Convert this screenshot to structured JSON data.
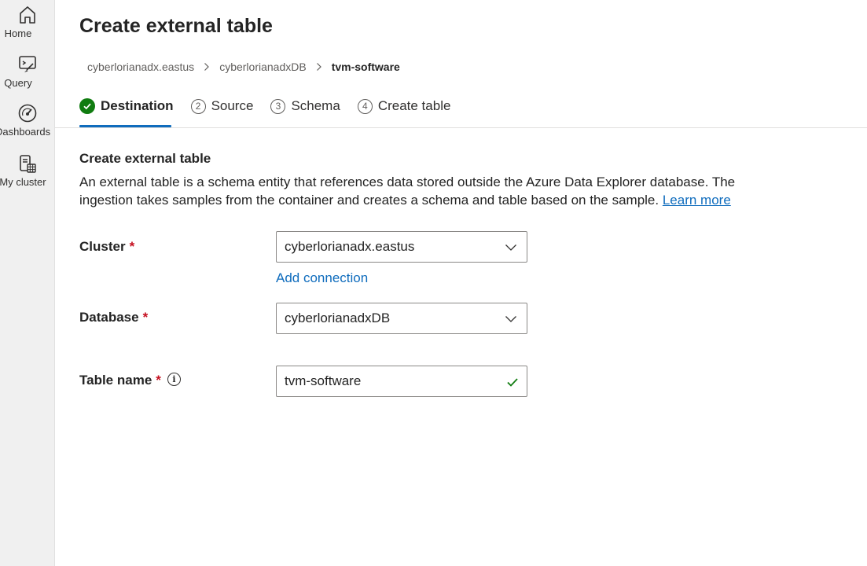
{
  "nav": {
    "items": [
      {
        "label": "Home",
        "icon": "home-icon"
      },
      {
        "label": "Query",
        "icon": "query-icon"
      },
      {
        "label": "Dashboards",
        "icon": "dashboard-gauge-icon"
      },
      {
        "label": "My cluster",
        "icon": "my-cluster-icon"
      }
    ]
  },
  "page": {
    "title": "Create external table"
  },
  "breadcrumb": {
    "items": [
      "cyberlorianadx.eastus",
      "cyberlorianadxDB",
      "tvm-software"
    ],
    "separator": ">"
  },
  "steps": [
    {
      "label": "Destination",
      "status": "completed",
      "number": "1"
    },
    {
      "label": "Source",
      "status": "pending",
      "number": "2"
    },
    {
      "label": "Schema",
      "status": "pending",
      "number": "3"
    },
    {
      "label": "Create table",
      "status": "pending",
      "number": "4"
    }
  ],
  "section": {
    "title": "Create external table",
    "description": "An external table is a schema entity that references data stored outside the Azure Data Explorer database. The ingestion takes samples from the container and creates a schema and table based on the sample.",
    "learn_more": "Learn more"
  },
  "form": {
    "required_marker": "*",
    "cluster": {
      "label": "Cluster",
      "value": "cyberlorianadx.eastus"
    },
    "add_connection": "Add connection",
    "database": {
      "label": "Database",
      "value": "cyberlorianadxDB"
    },
    "table_name": {
      "label": "Table name",
      "value": "tvm-software",
      "info_icon": "i",
      "valid": true
    }
  },
  "colors": {
    "accent": "#0f6cbd",
    "success": "#107c10",
    "required": "#c50f1f"
  }
}
